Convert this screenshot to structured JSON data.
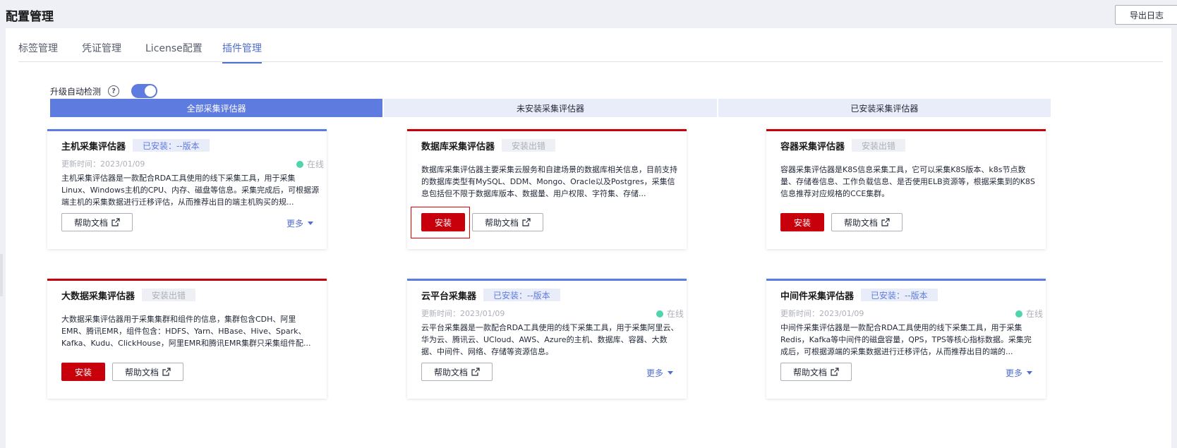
{
  "header": {
    "title": "配置管理",
    "export_label": "导出日志"
  },
  "tabs": [
    {
      "label": "标签管理",
      "active": false
    },
    {
      "label": "凭证管理",
      "active": false
    },
    {
      "label": "License配置",
      "active": false
    },
    {
      "label": "插件管理",
      "active": true
    }
  ],
  "auto_check": {
    "label": "升级自动检测",
    "help": "?",
    "enabled": true
  },
  "filters": [
    {
      "label": "全部采集评估器",
      "active": true
    },
    {
      "label": "未安装采集评估器",
      "active": false
    },
    {
      "label": "已安装采集评估器",
      "active": false
    }
  ],
  "common": {
    "install_label": "安装",
    "help_doc_label": "帮助文档",
    "more_label": "更多"
  },
  "cards": [
    {
      "title": "主机采集评估器",
      "badge": "已安装：--版本",
      "badge_type": "installed",
      "update_time": "更新时间：2023/01/09",
      "status": "在线",
      "description": "主机采集评估器是一款配合RDA工具使用的线下采集工具，用于采集Linux、Windows主机的CPU、内存、磁盘等信息。采集完成后，可根据源端主机的采集数据进行迁移评估，从而推荐出目的端主机购买的规..."
    },
    {
      "title": "数据库采集评估器",
      "badge": "安装出错",
      "badge_type": "failed",
      "description": "数据库采集评估器主要采集云服务和自建场景的数据库相关信息，目前支持的数据库类型有MySQL、DDM、Mongo、Oracle以及Postgres，采集信息包括但不限于数据库版本、数据量、用户权限、字符集、存储..."
    },
    {
      "title": "容器采集评估器",
      "badge": "安装出错",
      "badge_type": "failed",
      "description": "容器采集评估器是K8S信息采集工具，它可以采集K8S版本、k8s节点数量、存储卷信息、工作负载信息、是否使用ELB资源等，根据采集到的K8S信息推荐对应规格的CCE集群。"
    },
    {
      "title": "大数据采集评估器",
      "badge": "安装出错",
      "badge_type": "failed",
      "description": "大数据采集评估器用于采集集群和组件的信息，集群包含CDH、阿里EMR、腾讯EMR，组件包含：HDFS、Yarn、HBase、Hive、Spark、Kafka、Kudu、ClickHouse，阿里EMR和腾讯EMR集群只采集组件配..."
    },
    {
      "title": "云平台采集器",
      "badge": "已安装：--版本",
      "badge_type": "installed",
      "update_time": "更新时间：2023/01/09",
      "status": "在线",
      "description": "云平台采集器是一款配合RDA工具使用的线下采集工具，用于采集阿里云、华为云、腾讯云、UCloud、AWS、Azure的主机、数据库、容器、大数据、中间件、网络、存储等资源信息。"
    },
    {
      "title": "中间件采集评估器",
      "badge": "已安装：--版本",
      "badge_type": "installed",
      "update_time": "更新时间：2023/01/09",
      "status": "在线",
      "description": "中间件采集评估器是一款配合RDA工具使用的线下采集工具，用于采集Redis，Kafka等中间件的磁盘容量，QPS，TPS等核心指标数据。采集完成后，可根据源端的采集数据进行迁移评估，从而推荐出目的端的..."
    }
  ],
  "colors": {
    "primary": "#5e7ce0",
    "danger": "#c7000b",
    "online": "#50d4ab"
  }
}
